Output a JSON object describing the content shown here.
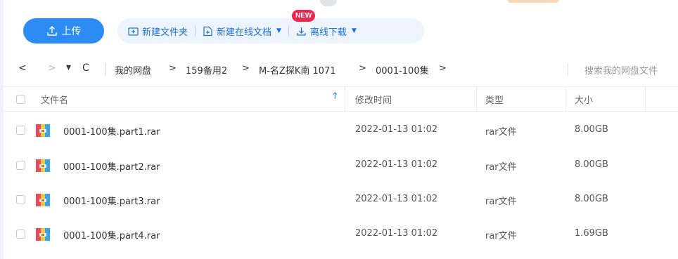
{
  "toolbar": {
    "upload_label": "上传",
    "new_folder_label": "新建文件夹",
    "new_online_doc_label": "新建在线文档",
    "new_badge": "NEW",
    "offline_download_label": "离线下载",
    "caret": "▼"
  },
  "nav": {
    "back": "<",
    "forward": ">",
    "dropdown": "▾",
    "refresh": "C",
    "breadcrumb": [
      "我的网盘",
      "159备用2",
      "M-名Z探K南 1071",
      "0001-100集"
    ],
    "crumb_sep": ">",
    "search_placeholder": "搜索我的网盘文件"
  },
  "table": {
    "headers": {
      "name": "文件名",
      "modified": "修改时间",
      "type": "类型",
      "size": "大小"
    },
    "sort_indicator": "↑",
    "rows": [
      {
        "name": "0001-100集.part1.rar",
        "modified": "2022-01-13 01:02",
        "type": "rar文件",
        "size": "8.00GB"
      },
      {
        "name": "0001-100集.part2.rar",
        "modified": "2022-01-13 01:02",
        "type": "rar文件",
        "size": "8.00GB"
      },
      {
        "name": "0001-100集.part3.rar",
        "modified": "2022-01-13 01:02",
        "type": "rar文件",
        "size": "8.00GB"
      },
      {
        "name": "0001-100集.part4.rar",
        "modified": "2022-01-13 01:02",
        "type": "rar文件",
        "size": "1.69GB"
      }
    ]
  },
  "colors": {
    "accent": "#2c8cf4",
    "badge": "#f1264d",
    "group_bg": "#eef4fe"
  }
}
